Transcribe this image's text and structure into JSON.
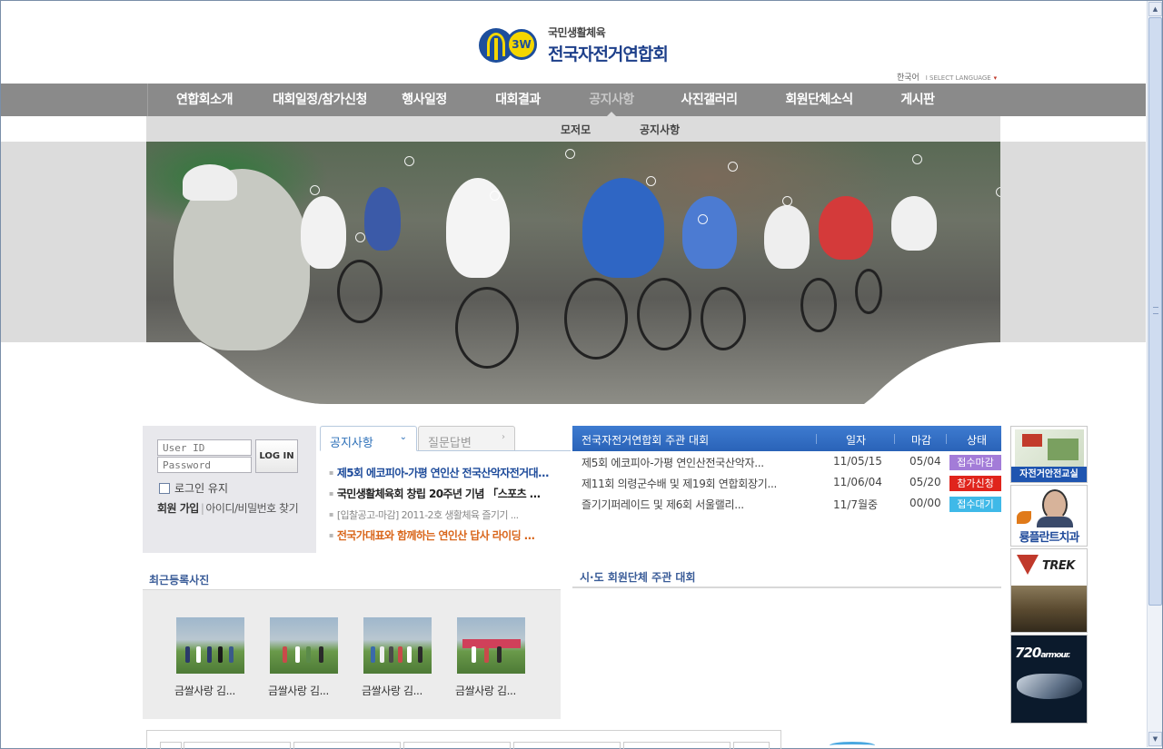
{
  "header": {
    "logo_sub": "국민생활체육",
    "logo_main": "전국자전거연합회",
    "logo_mark_text": "3W",
    "lang_korean": "한국어",
    "lang_select": "I SELECT LANGUAGE",
    "lang_arrow": "▾"
  },
  "nav": {
    "items": [
      "연합회소개",
      "대회일정/참가신청",
      "행사일정",
      "대회결과",
      "공지사항",
      "사진갤러리",
      "회원단체소식",
      "게시판"
    ],
    "active_index": 4,
    "sub_items": [
      "모저모",
      "공지사항"
    ]
  },
  "login": {
    "id_placeholder": "User ID",
    "pw_placeholder": "Password",
    "button": "LOG IN",
    "keep": "로그인 유지",
    "join": "회원 가입",
    "sep": "|",
    "find": "아이디/비밀번호 찾기"
  },
  "notice_tabs": {
    "active": "공지사항",
    "inactive": "질문답변",
    "chev_active": "⌄",
    "chev_inactive": "›",
    "items": [
      "제5회 에코피아-가평 연인산 전국산악자전거대...",
      "국민생활체육회 창립 20주년 기념 「스포츠 ...",
      "[입찰공고-마감] 2011-2호 생활체육 즐기기 ...",
      "전국가대표와 함께하는 연인산 답사 라이딩 ..."
    ]
  },
  "events": {
    "header": {
      "title": "전국자전거연합회 주관 대회",
      "date": "일자",
      "deadline": "마감",
      "status": "상태"
    },
    "rows": [
      {
        "title": "제5회 에코피아-가평 연인산전국산악자...",
        "date": "11/05/15",
        "deadline": "05/04",
        "status": "접수마감",
        "color": "#a37cd8"
      },
      {
        "title": "제11회 의령군수배 및 제19회 연합회장기...",
        "date": "11/06/04",
        "deadline": "05/20",
        "status": "참가신청",
        "color": "#e0241c"
      },
      {
        "title": "즐기기퍼레이드 및 제6회 서울랠리...",
        "date": "11/7월중",
        "deadline": "00/00",
        "status": "접수대기",
        "color": "#3fb9e8"
      }
    ]
  },
  "sections": {
    "recent_photos": "최근등록사진",
    "regional_events": "시·도 회원단체 주관 대회"
  },
  "photos": {
    "captions": [
      "금쌀사랑 김...",
      "금쌀사랑 김...",
      "금쌀사랑 김...",
      "금쌀사랑 김..."
    ]
  },
  "ads": {
    "ad1_caption": "자전거안전교실",
    "ad2_caption": "룡플란트치과",
    "ad3_brand": "TREK",
    "ad4_brand": "720",
    "ad4_brand_suffix": "armour."
  },
  "scrollbar": {
    "up": "▲",
    "down": "▼"
  },
  "colors": {
    "nav_bg": "#8a8a8a",
    "event_header": "#2a63b8",
    "accent_blue": "#2b6fb8",
    "notice_orange": "#d9661b"
  }
}
